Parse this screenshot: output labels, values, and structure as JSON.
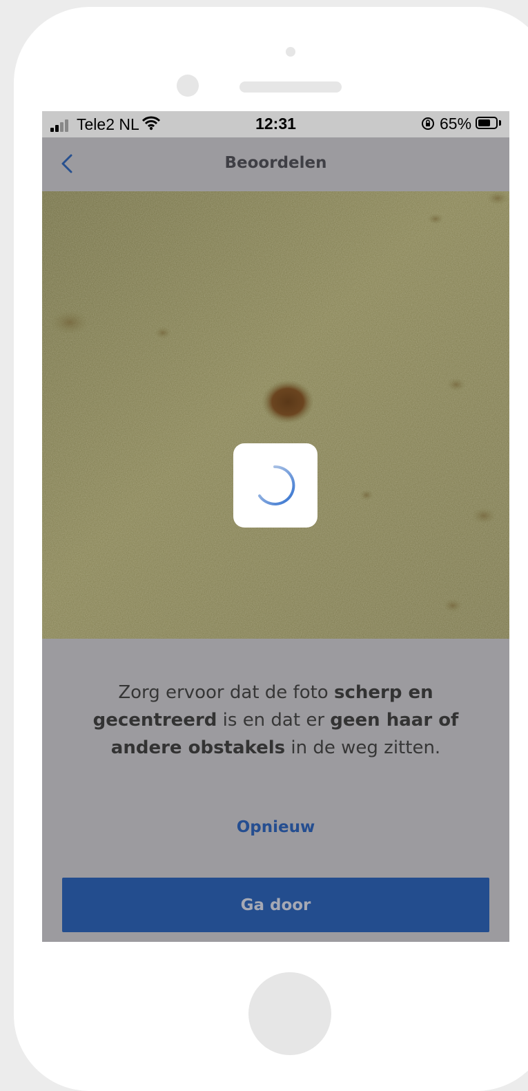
{
  "status_bar": {
    "carrier": "Tele2 NL",
    "time": "12:31",
    "battery": "65%",
    "icons": [
      "signal-icon",
      "wifi-icon",
      "orientation-lock-icon",
      "battery-icon"
    ]
  },
  "nav": {
    "back_icon": "chevron-left-icon",
    "title": "Beoordelen"
  },
  "photo": {
    "description_icon": "skin-photo",
    "loading_icon": "spinner-icon"
  },
  "instructions": {
    "part1": "Zorg ervoor dat de foto ",
    "bold1": "scherp en gecentreerd",
    "part2": " is en dat er ",
    "bold2": "geen haar of andere obstakels",
    "part3": " in de weg zitten."
  },
  "actions": {
    "retry_label": "Opnieuw",
    "continue_label": "Ga door"
  },
  "colors": {
    "accent": "#234d8e",
    "overlay": "#9c9b9f",
    "statusbar": "#c9c9c9"
  }
}
